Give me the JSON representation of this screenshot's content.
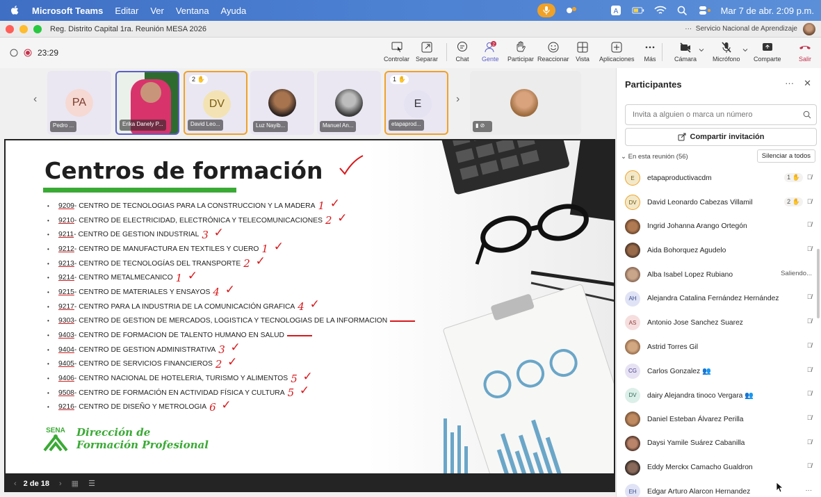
{
  "menubar": {
    "app": "Microsoft Teams",
    "menus": [
      "Editar",
      "Ver",
      "Ventana",
      "Ayuda"
    ],
    "datetime": "Mar 7 de abr.  2:09 p.m."
  },
  "titlebar": {
    "title": "Reg. Distrito Capital 1ra. Reunión MESA 2026",
    "org_dots": "···",
    "org": "Servicio Nacional de Aprendizaje"
  },
  "toolbar": {
    "timer": "23:29",
    "buttons": {
      "controlar": "Controlar",
      "separar": "Separar",
      "chat": "Chat",
      "gente": "Gente",
      "gente_badge": "2",
      "participar": "Participar",
      "reaccionar": "Reaccionar",
      "vista": "Vista",
      "aplicaciones": "Aplicaciones",
      "mas": "Más",
      "camara": "Cámara",
      "microfono": "Micrófono",
      "comparte": "Comparte",
      "salir": "Salir"
    }
  },
  "strip": {
    "tiles": [
      {
        "initials": "PA",
        "name": "Pedro ...",
        "reaction": ""
      },
      {
        "initials": "",
        "name": "Erika Danely P...",
        "reaction": ""
      },
      {
        "initials": "DV",
        "name": "David Leo...",
        "reaction": "2"
      },
      {
        "initials": "",
        "name": "Luz Nayib...",
        "reaction": ""
      },
      {
        "initials": "",
        "name": "Manuel An...",
        "reaction": ""
      },
      {
        "initials": "E",
        "name": "etapaprod...",
        "reaction": "1"
      },
      {
        "initials": "",
        "name": "",
        "reaction": ""
      }
    ]
  },
  "slide": {
    "title": "Centros de formación",
    "items": [
      {
        "code": "9209",
        "text": " - CENTRO DE TECNOLOGIAS PARA LA CONSTRUCCION Y LA MADERA"
      },
      {
        "code": "9210",
        "text": " - CENTRO DE ELECTRICIDAD, ELECTRÓNICA Y TELECOMUNICACIONES"
      },
      {
        "code": "9211",
        "text": " - CENTRO DE GESTION INDUSTRIAL"
      },
      {
        "code": "9212",
        "text": " - CENTRO DE MANUFACTURA EN TEXTILES Y CUERO"
      },
      {
        "code": "9213",
        "text": " - CENTRO DE TECNOLOGÍAS DEL TRANSPORTE"
      },
      {
        "code": "9214",
        "text": " - CENTRO METALMECANICO"
      },
      {
        "code": "9215",
        "text": " - CENTRO DE MATERIALES Y ENSAYOS"
      },
      {
        "code": "9217",
        "text": " - CENTRO PARA LA INDUSTRIA DE LA COMUNICACIÓN GRAFICA"
      },
      {
        "code": "9303",
        "text": " - CENTRO DE GESTION DE MERCADOS, LOGISTICA Y TECNOLOGIAS DE LA INFORMACION"
      },
      {
        "code": "9403",
        "text": " - CENTRO DE FORMACION DE TALENTO HUMANO EN SALUD"
      },
      {
        "code": "9404",
        "text": " - CENTRO DE GESTION ADMINISTRATIVA"
      },
      {
        "code": "9405",
        "text": " - CENTRO DE SERVICIOS FINANCIEROS"
      },
      {
        "code": "9406",
        "text": " - CENTRO NACIONAL DE HOTELERIA, TURISMO Y ALIMENTOS"
      },
      {
        "code": "9508",
        "text": " - CENTRO DE FORMACIÓN EN ACTIVIDAD FÍSICA Y CULTURA"
      },
      {
        "code": "9216",
        "text": " - CENTRO DE DISEÑO Y METROLOGIA"
      }
    ],
    "annotations": [
      "1",
      "2",
      "3",
      "1",
      "2",
      "1",
      "4",
      "4",
      "",
      "",
      "3",
      "2",
      "5",
      "5",
      "6"
    ],
    "logo_text": "SENA",
    "brand_line1": "Dirección de",
    "brand_line2": "Formación Profesional",
    "page": "2 de 18"
  },
  "panel": {
    "title": "Participantes",
    "invite_placeholder": "Invita a alguien o marca un número",
    "share_label": "Compartir invitación",
    "in_meeting": "En esta reunión (56)",
    "mute_all": "Silenciar a todos",
    "participants": [
      {
        "initials": "E",
        "name": "etapaproductivacdm",
        "hand": "1",
        "status": ""
      },
      {
        "initials": "DV",
        "name": "David Leonardo Cabezas Villamil",
        "hand": "2",
        "status": ""
      },
      {
        "initials": "",
        "name": "Ingrid Johanna Arango Ortegón",
        "hand": "",
        "status": ""
      },
      {
        "initials": "",
        "name": "Aida Bohorquez Agudelo",
        "hand": "",
        "status": ""
      },
      {
        "initials": "",
        "name": "Alba Isabel Lopez Rubiano",
        "hand": "",
        "status": "Saliendo..."
      },
      {
        "initials": "AH",
        "name": "Alejandra Catalina Fernández Hernández",
        "hand": "",
        "status": ""
      },
      {
        "initials": "AS",
        "name": "Antonio Jose Sanchez Suarez",
        "hand": "",
        "status": ""
      },
      {
        "initials": "",
        "name": "Astrid Torres Gil",
        "hand": "",
        "status": ""
      },
      {
        "initials": "CG",
        "name": "Carlos Gonzalez",
        "hand": "",
        "status": ""
      },
      {
        "initials": "DV",
        "name": "dairy Alejandra tinoco Vergara",
        "hand": "",
        "status": ""
      },
      {
        "initials": "",
        "name": "Daniel Esteban Álvarez Perilla",
        "hand": "",
        "status": ""
      },
      {
        "initials": "",
        "name": "Daysi Yamile Suárez Cabanilla",
        "hand": "",
        "status": ""
      },
      {
        "initials": "",
        "name": "Eddy Merckx Camacho Gualdron",
        "hand": "",
        "status": ""
      },
      {
        "initials": "EH",
        "name": "Edgar Arturo Alarcon Hernandez",
        "hand": "",
        "status": ""
      }
    ]
  },
  "colors": {
    "accent": "#5b5fc7",
    "sena_green": "#3aaa35",
    "ink_red": "#d7191c",
    "hand_yellow": "#f0a127"
  }
}
